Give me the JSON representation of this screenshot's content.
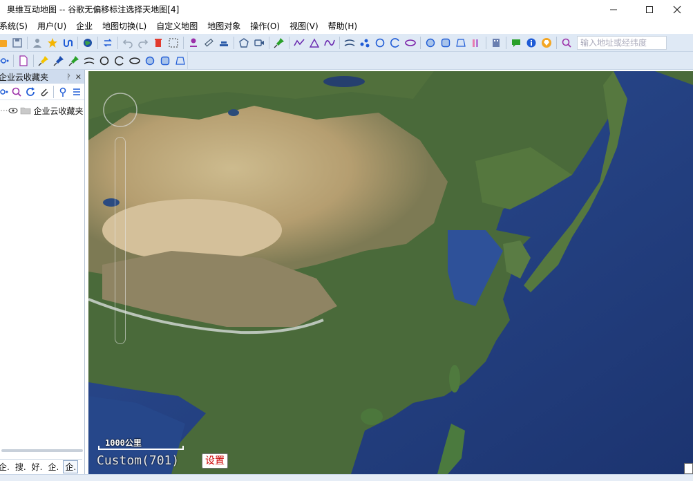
{
  "window": {
    "title": "奥维互动地图 -- 谷歌无偏移标注选择天地图[4]"
  },
  "menu": [
    "系统(S)",
    "用户(U)",
    "企业",
    "地图切换(L)",
    "自定义地图",
    "地图对象",
    "操作(O)",
    "视图(V)",
    "帮助(H)"
  ],
  "toolbar": {
    "search_placeholder": "输入地址或经纬度"
  },
  "panel": {
    "title": "企业云收藏夹",
    "tree_item": "企业云收藏夹"
  },
  "bottom_tabs": [
    "企.",
    "搜.",
    "好.",
    "企.",
    "企."
  ],
  "map": {
    "scale_label": "1000公里",
    "custom_label": "Custom(701)",
    "settings_label": "设置"
  },
  "colors": {
    "toolbar_bg": "#dfe9f5",
    "panel_header_bg": "#cfdcee",
    "ocean": "#2b4a8a",
    "land_green": "#4c6b3a",
    "desert": "#c8b487",
    "settings_text": "#cc0000"
  }
}
